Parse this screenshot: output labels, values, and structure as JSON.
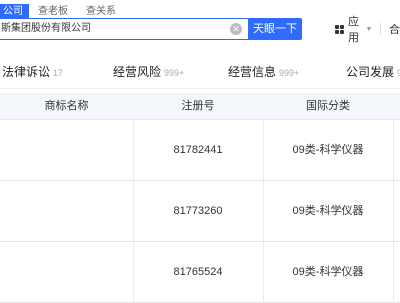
{
  "top_tabs": [
    {
      "label": "公司",
      "active": true
    },
    {
      "label": "查老板",
      "active": false
    },
    {
      "label": "查关系",
      "active": false
    }
  ],
  "search": {
    "value": "斯集团股份有限公司",
    "button_label": "天眼一下"
  },
  "apps": {
    "label": "应用",
    "more_label": "合"
  },
  "nav": {
    "items": [
      {
        "label": "法律诉讼",
        "count": "17"
      },
      {
        "label": "经营风险",
        "count": "999+"
      },
      {
        "label": "经营信息",
        "count": "999+"
      },
      {
        "label": "公司发展",
        "count": "9"
      }
    ]
  },
  "table": {
    "headers": [
      "商标名称",
      "注册号",
      "国际分类"
    ],
    "rows": [
      {
        "name": "",
        "reg_no": "81782441",
        "class": "09类-科学仪器"
      },
      {
        "name": "",
        "reg_no": "81773260",
        "class": "09类-科学仪器"
      },
      {
        "name": "",
        "reg_no": "81765524",
        "class": "09类-科学仪器"
      }
    ]
  }
}
